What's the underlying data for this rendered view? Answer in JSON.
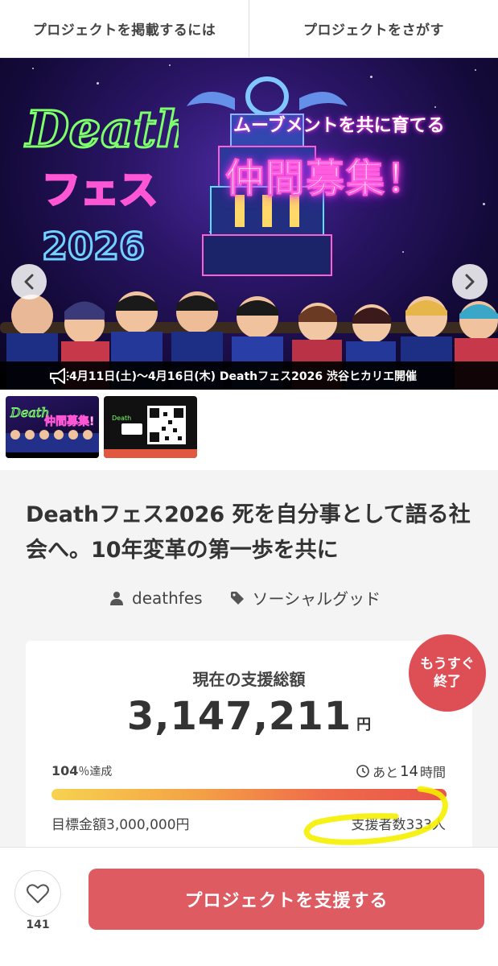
{
  "nav": {
    "left_label": "プロジェクトを掲載するには",
    "right_label": "プロジェクトをさがす"
  },
  "hero": {
    "slogan_line1": "ムーブメントを共に育てる",
    "slogan_line2": "仲間募集！",
    "neon_title_line1": "Death",
    "neon_title_line2": "フェス",
    "neon_year": "2026",
    "caption": "4月11日(土)〜4月16日(木)  Deathフェス2026 渋谷ヒカリエ開催"
  },
  "project": {
    "title": "Deathフェス2026 死を自分事として語る社会へ。10年変革の第一歩を共に",
    "owner": "deathfes",
    "category": "ソーシャルグッド"
  },
  "funding": {
    "label": "現在の支援総額",
    "amount": "3,147,211",
    "unit": "円",
    "percent_value": "104",
    "percent_suffix": "％達成",
    "percent": 104,
    "time_prefix": "あと",
    "time_value": "14",
    "time_unit": "時間",
    "goal": "目標金額3,000,000円",
    "backers": "支援者数333人"
  },
  "badge": {
    "line1": "もうすぐ",
    "line2": "終了"
  },
  "bottom": {
    "favorite_count": "141",
    "support_label": "プロジェクトを支援する"
  },
  "colors": {
    "accent": "#de5b62",
    "badge": "#de4f55",
    "highlight": "#f5f000"
  }
}
